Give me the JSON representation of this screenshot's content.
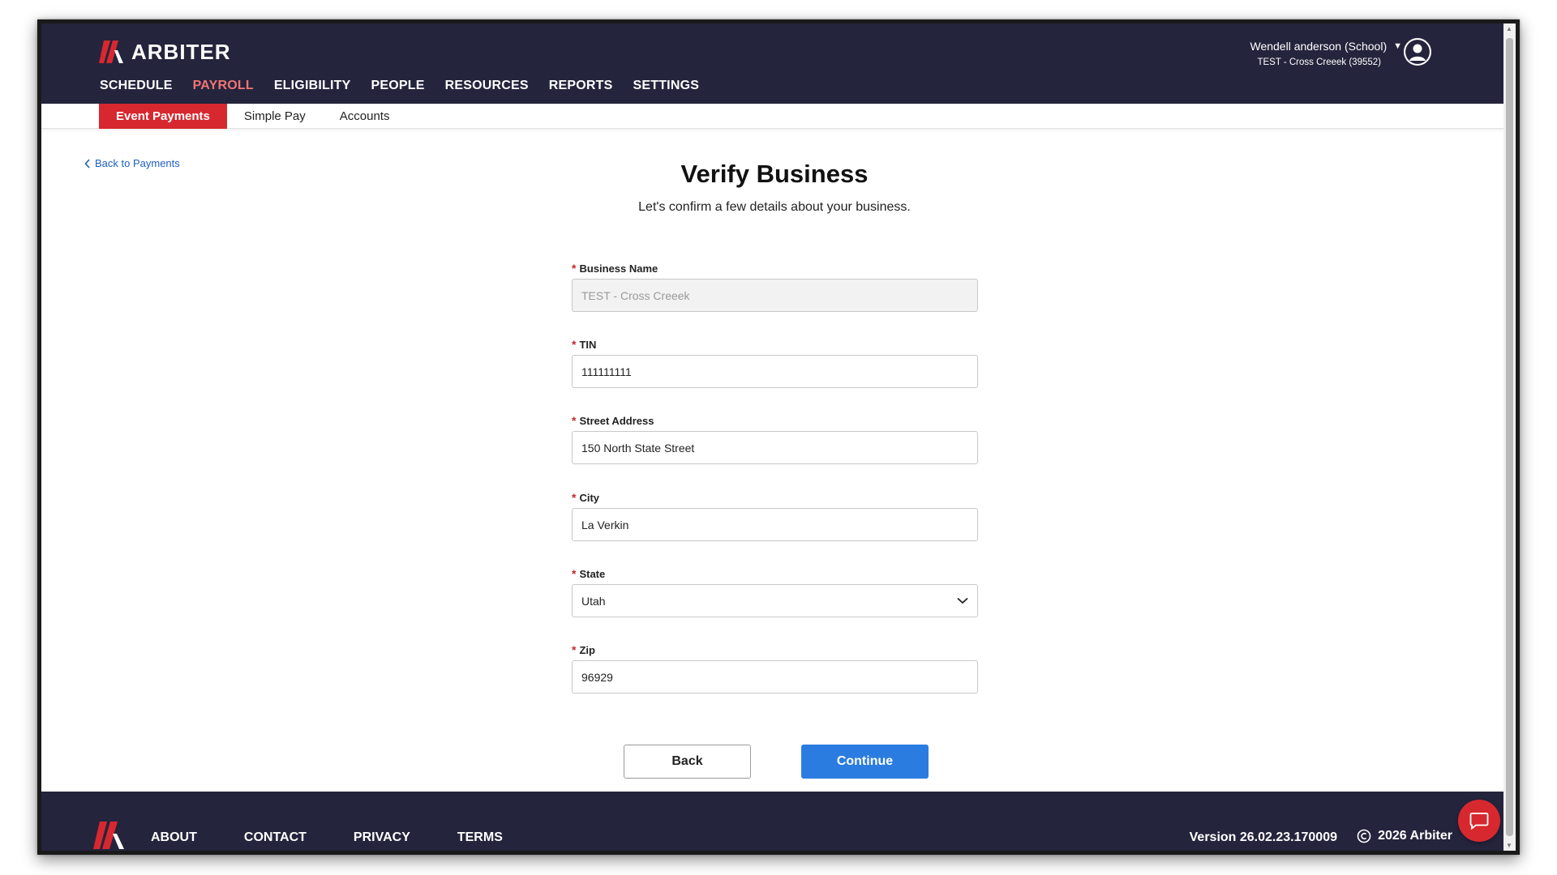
{
  "brand": {
    "name": "ARBITER"
  },
  "header": {
    "nav": [
      {
        "label": "SCHEDULE",
        "active": false
      },
      {
        "label": "PAYROLL",
        "active": true
      },
      {
        "label": "ELIGIBILITY",
        "active": false
      },
      {
        "label": "PEOPLE",
        "active": false
      },
      {
        "label": "RESOURCES",
        "active": false
      },
      {
        "label": "REPORTS",
        "active": false
      },
      {
        "label": "SETTINGS",
        "active": false
      }
    ],
    "user": {
      "name": "Wendell anderson (School)",
      "org": "TEST - Cross Creeek (39552)"
    }
  },
  "subnav": {
    "tabs": [
      {
        "label": "Event Payments",
        "active": true
      },
      {
        "label": "Simple Pay",
        "active": false
      },
      {
        "label": "Accounts",
        "active": false
      }
    ]
  },
  "page": {
    "back_link": "Back to Payments",
    "title": "Verify Business",
    "subtitle": "Let's confirm a few details about your business."
  },
  "form": {
    "required_marker": "*",
    "business_name": {
      "label": "Business Name",
      "value": "TEST - Cross Creeek",
      "disabled": true
    },
    "tin": {
      "label": "TIN",
      "value": "111111111"
    },
    "street": {
      "label": "Street Address",
      "value": "150 North State Street"
    },
    "city": {
      "label": "City",
      "value": "La Verkin"
    },
    "state": {
      "label": "State",
      "value": "Utah"
    },
    "zip": {
      "label": "Zip",
      "value": "96929"
    }
  },
  "buttons": {
    "back": "Back",
    "continue": "Continue"
  },
  "footer": {
    "links": [
      "ABOUT",
      "CONTACT",
      "PRIVACY",
      "TERMS"
    ],
    "version": "Version 26.02.23.170009",
    "copyright": "2026 Arbiter"
  },
  "colors": {
    "header_bg": "#25243d",
    "brand_red": "#d7282f",
    "nav_active": "#f07575",
    "primary": "#2b7ce0",
    "link": "#1f5fbf"
  },
  "icons": {
    "user": "user-icon",
    "chat": "chat-icon",
    "back": "chevron-left-icon",
    "select": "chevron-down-icon"
  }
}
